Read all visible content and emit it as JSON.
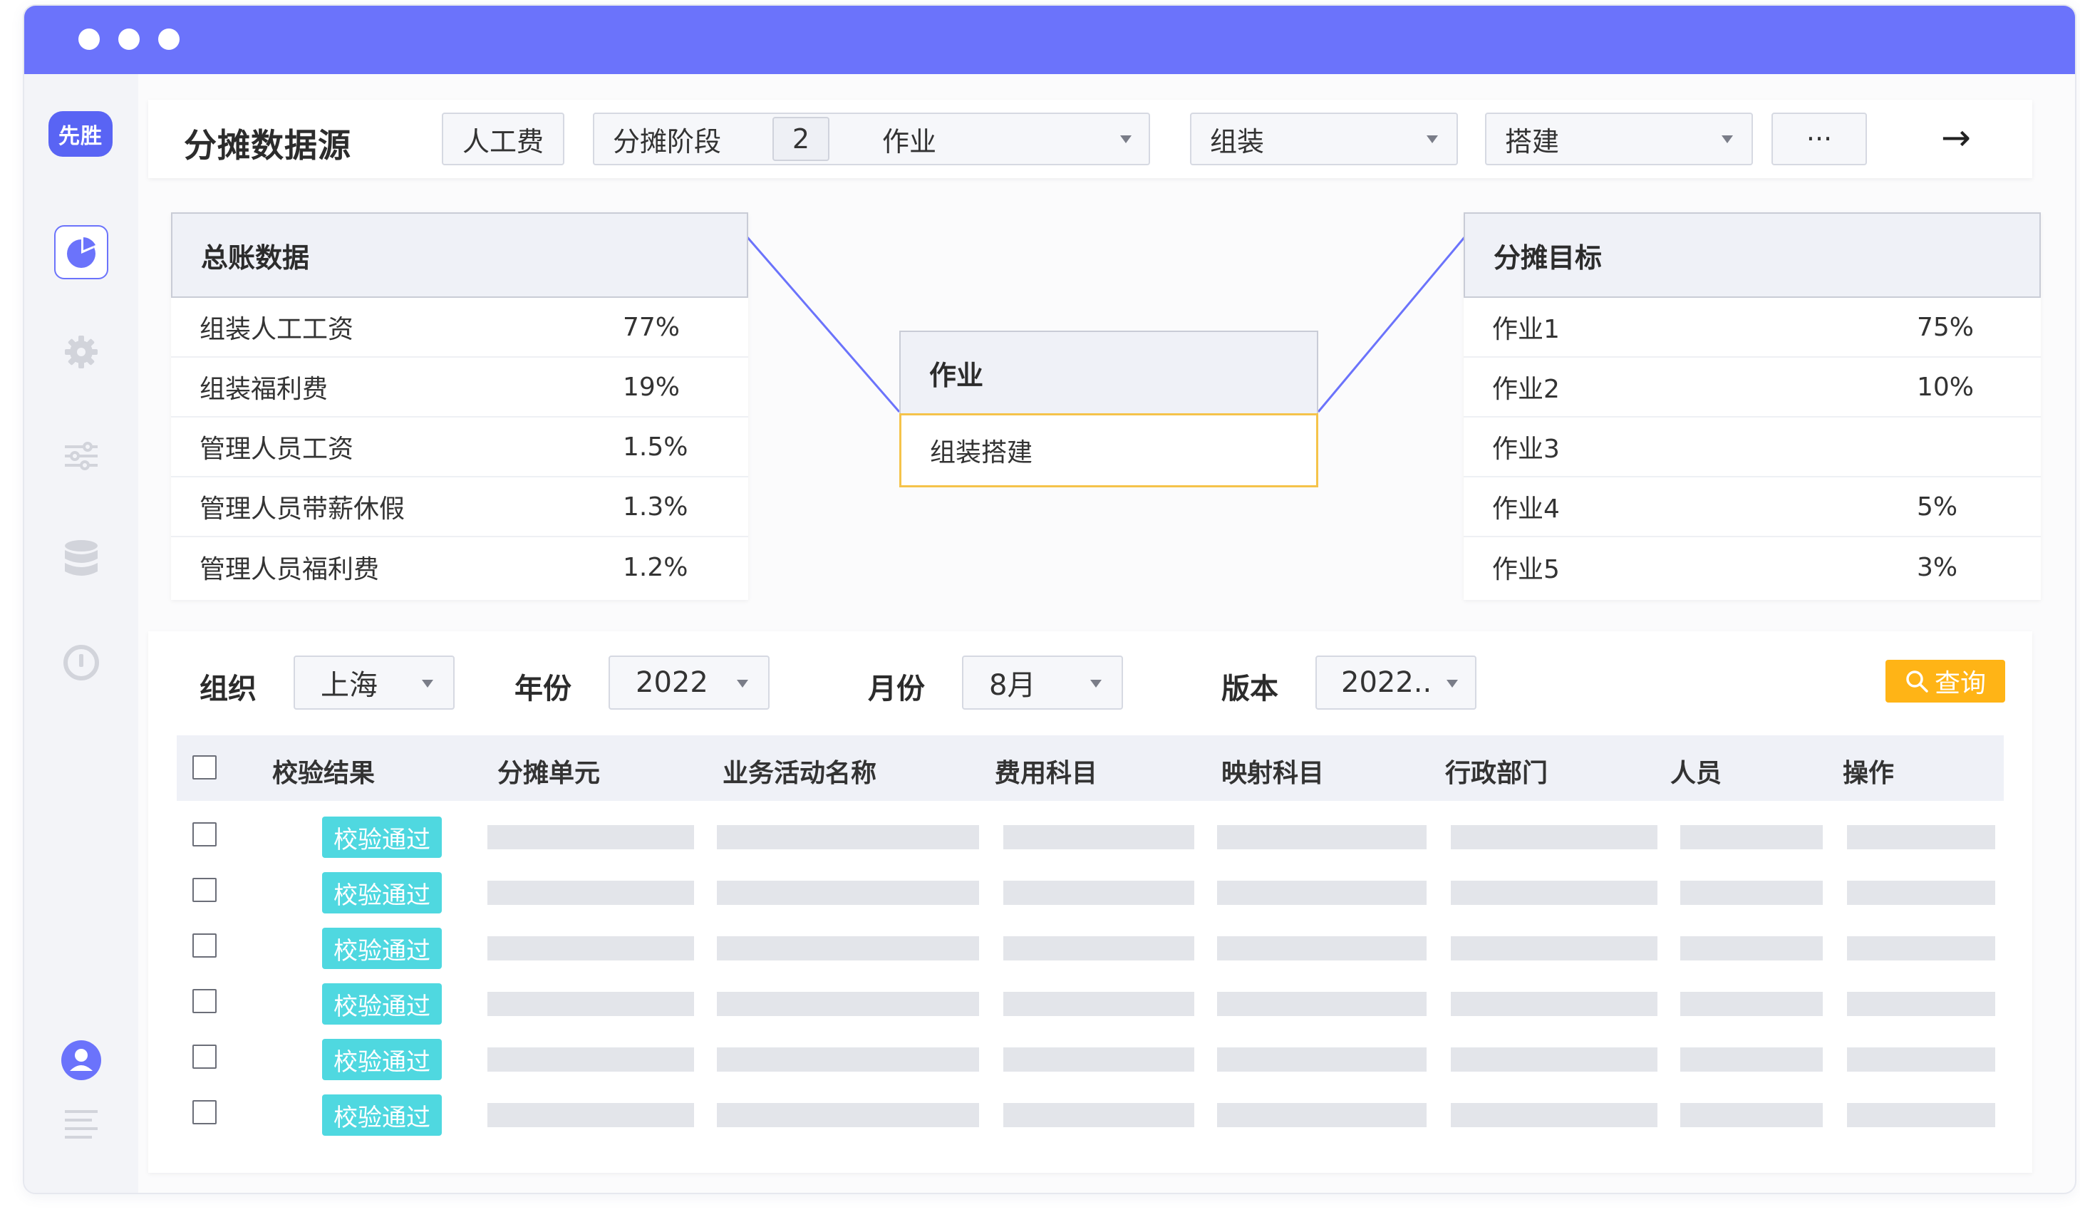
{
  "app": {
    "logo_text": "先胜"
  },
  "topbar": {
    "title": "分摊数据源",
    "chip_cost": "人工费",
    "stage_label": "分摊阶段",
    "stage_value": "2",
    "stage_select": "作业",
    "select_2": "组装",
    "select_3": "搭建",
    "more": "···",
    "arrow": "→"
  },
  "ledger": {
    "title": "总账数据",
    "rows": [
      {
        "name": "组装人工工资",
        "pct": "77%"
      },
      {
        "name": "组装福利费",
        "pct": "19%"
      },
      {
        "name": "管理人员工资",
        "pct": "1.5%"
      },
      {
        "name": "管理人员带薪休假",
        "pct": "1.3%"
      },
      {
        "name": "管理人员福利费",
        "pct": "1.2%"
      }
    ]
  },
  "activity": {
    "title": "作业",
    "value": "组装搭建"
  },
  "target": {
    "title": "分摊目标",
    "rows": [
      {
        "name": "作业1",
        "pct": "75%"
      },
      {
        "name": "作业2",
        "pct": "10%"
      },
      {
        "name": "作业3",
        "pct": ""
      },
      {
        "name": "作业4",
        "pct": "5%"
      },
      {
        "name": "作业5",
        "pct": "3%"
      }
    ]
  },
  "filters": {
    "org_label": "组织",
    "org_value": "上海",
    "year_label": "年份",
    "year_value": "2022",
    "month_label": "月份",
    "month_value": "8月",
    "version_label": "版本",
    "version_value": "2022..",
    "query_label": "查询"
  },
  "table": {
    "headers": [
      "校验结果",
      "分摊单元",
      "业务活动名称",
      "费用科目",
      "映射科目",
      "行政部门",
      "人员",
      "操作"
    ],
    "rows": [
      "校验通过",
      "校验通过",
      "校验通过",
      "校验通过",
      "校验通过",
      "校验通过"
    ]
  },
  "colors": {
    "titlebar": "#6b73fb",
    "accent": "#5964f4",
    "query_button": "#ffb416",
    "pass_tag": "#4fd8e0",
    "node_border": "#f5c34a"
  },
  "icons": [
    "pie-chart-icon",
    "gear-icon",
    "sliders-icon",
    "database-icon",
    "gauge-icon",
    "user-icon",
    "list-icon",
    "search-icon",
    "arrow-right-icon"
  ]
}
